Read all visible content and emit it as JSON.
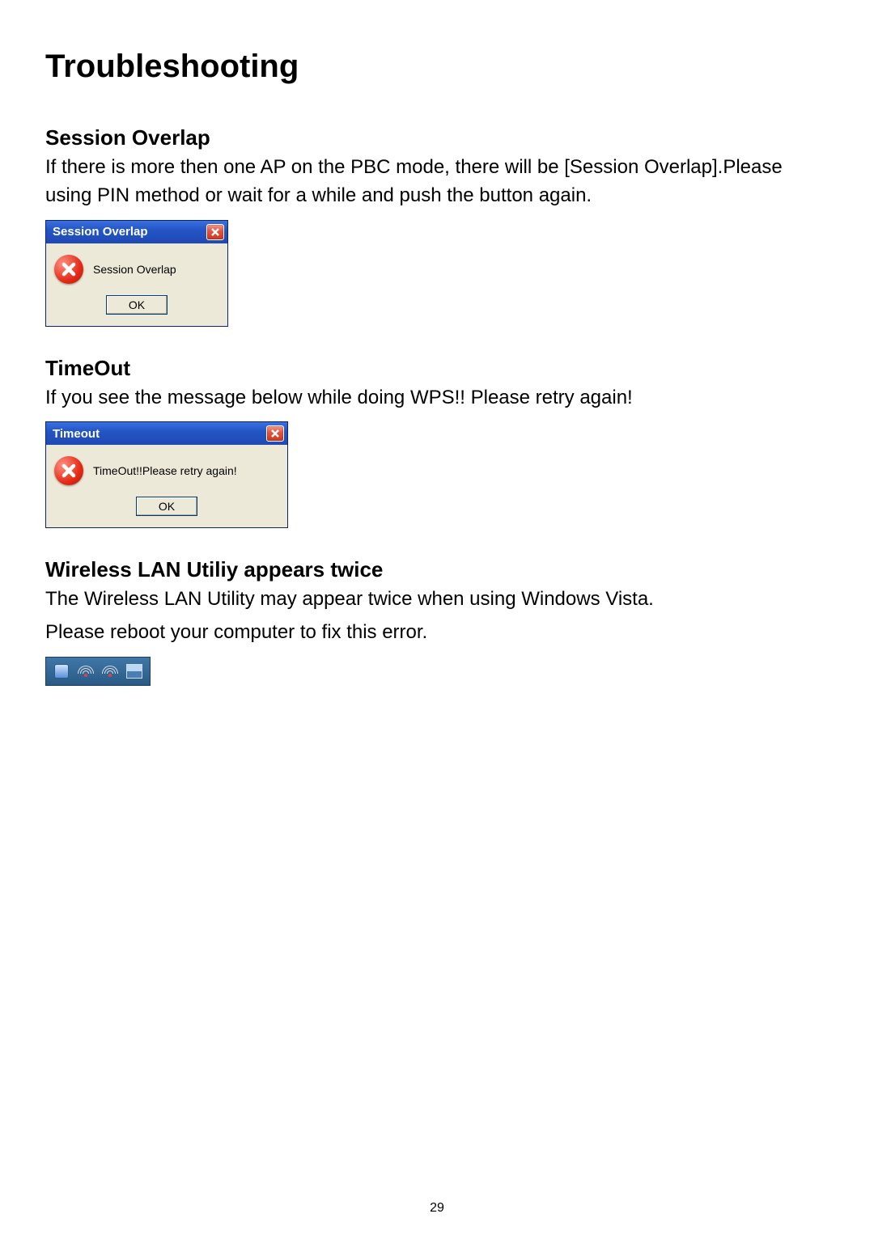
{
  "page": {
    "title": "Troubleshooting",
    "number": "29"
  },
  "sections": {
    "session_overlap": {
      "heading": "Session Overlap",
      "body": "If there is more then one AP on the PBC mode, there will be [Session Overlap].Please using PIN method or wait for a while and push the button again.",
      "dialog": {
        "title": "Session Overlap",
        "message": "Session Overlap",
        "ok": "OK"
      }
    },
    "timeout": {
      "heading": "TimeOut",
      "body": "If you see the message below while doing WPS!! Please retry again!",
      "dialog": {
        "title": "Timeout",
        "message": "TimeOut!!Please retry again!",
        "ok": "OK"
      }
    },
    "utility_twice": {
      "heading": "Wireless LAN Utiliy appears twice",
      "body1": "The Wireless LAN Utility may appear twice when using Windows Vista.",
      "body2": "Please reboot your computer to fix this error."
    }
  }
}
